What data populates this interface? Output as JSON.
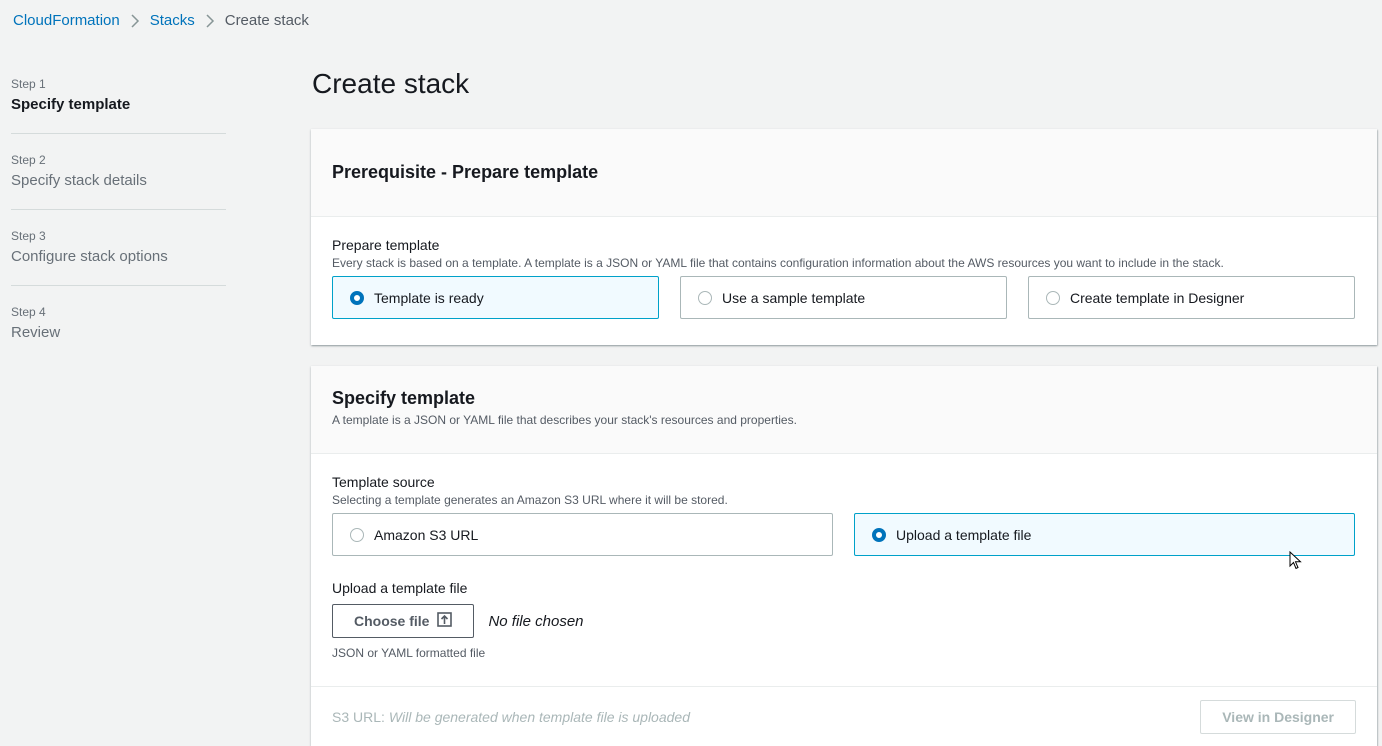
{
  "breadcrumb": {
    "items": [
      "CloudFormation",
      "Stacks"
    ],
    "current": "Create stack"
  },
  "steps": [
    {
      "num": "Step 1",
      "label": "Specify template",
      "active": true
    },
    {
      "num": "Step 2",
      "label": "Specify stack details",
      "active": false
    },
    {
      "num": "Step 3",
      "label": "Configure stack options",
      "active": false
    },
    {
      "num": "Step 4",
      "label": "Review",
      "active": false
    }
  ],
  "page_title": "Create stack",
  "prerequisite": {
    "header": "Prerequisite - Prepare template",
    "field_label": "Prepare template",
    "field_desc": "Every stack is based on a template. A template is a JSON or YAML file that contains configuration information about the AWS resources you want to include in the stack.",
    "options": [
      {
        "label": "Template is ready",
        "selected": true
      },
      {
        "label": "Use a sample template",
        "selected": false
      },
      {
        "label": "Create template in Designer",
        "selected": false
      }
    ]
  },
  "specify": {
    "header": "Specify template",
    "desc": "A template is a JSON or YAML file that describes your stack's resources and properties.",
    "source_label": "Template source",
    "source_desc": "Selecting a template generates an Amazon S3 URL where it will be stored.",
    "source_options": [
      {
        "label": "Amazon S3 URL",
        "selected": false
      },
      {
        "label": "Upload a template file",
        "selected": true
      }
    ],
    "upload_label": "Upload a template file",
    "choose_file": "Choose file",
    "no_file": "No file chosen",
    "upload_hint": "JSON or YAML formatted file",
    "s3_label": "S3 URL:",
    "s3_placeholder": "Will be generated when template file is uploaded",
    "view_designer": "View in Designer"
  },
  "colors": {
    "link": "#0073bb",
    "selected_border": "#00a1c9",
    "selected_bg": "#f1faff"
  }
}
